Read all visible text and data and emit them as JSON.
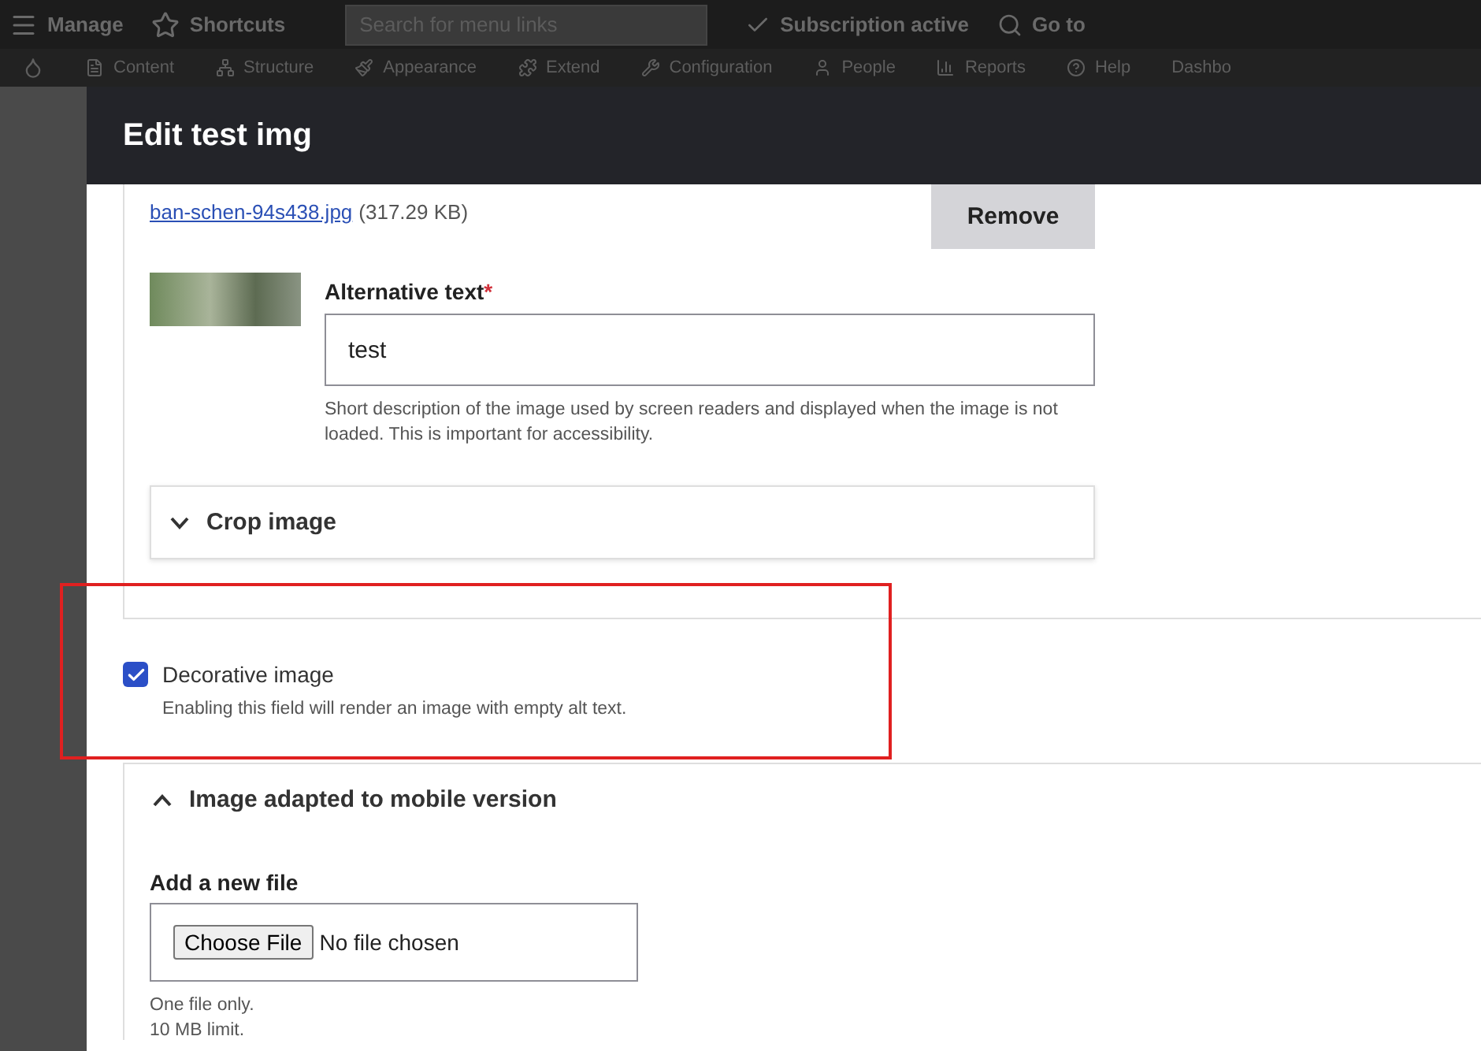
{
  "toolbar": {
    "items": [
      {
        "kind": "manage",
        "label": "Manage"
      },
      {
        "kind": "shortcuts",
        "label": "Shortcuts"
      }
    ],
    "search": {
      "placeholder": "Search for menu links"
    },
    "status": "Subscription active",
    "goto": "Go to"
  },
  "admin_menu": [
    {
      "kind": "content",
      "label": "Content"
    },
    {
      "kind": "structure",
      "label": "Structure"
    },
    {
      "kind": "appearance",
      "label": "Appearance"
    },
    {
      "kind": "extend",
      "label": "Extend"
    },
    {
      "kind": "config",
      "label": "Configuration"
    },
    {
      "kind": "people",
      "label": "People"
    },
    {
      "kind": "reports",
      "label": "Reports"
    },
    {
      "kind": "help",
      "label": "Help"
    },
    {
      "kind": "plain",
      "label": "Dashbo"
    }
  ],
  "dialog": {
    "title": "Edit test img",
    "file": {
      "name": "ban-schen-94s438.jpg",
      "size": "(317.29 KB)",
      "remove": "Remove"
    },
    "alt": {
      "label": "Alternative text",
      "required_mark": "*",
      "value": "test",
      "description": "Short description of the image used by screen readers and displayed when the image is not loaded. This is important for accessibility."
    },
    "crop": {
      "label": "Crop image",
      "expanded": false
    },
    "decorative": {
      "label": "Decorative image",
      "checked": true,
      "highlighted": true,
      "description": "Enabling this field will render an image with empty alt text."
    },
    "mobile": {
      "label": "Image adapted to mobile version",
      "expanded": true,
      "add_label": "Add a new file",
      "button": "Choose File",
      "status": "No file chosen",
      "notes": [
        "One file only.",
        "10 MB limit."
      ]
    }
  }
}
